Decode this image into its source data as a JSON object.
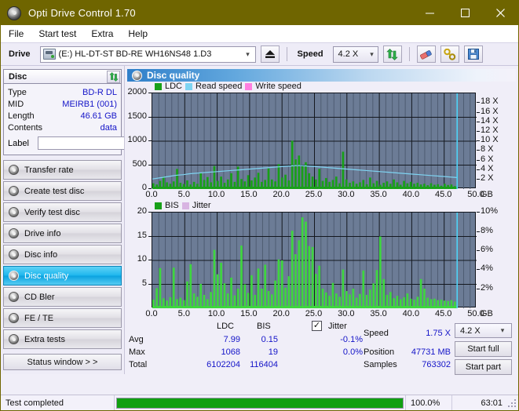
{
  "window": {
    "title": "Opti Drive Control 1.70",
    "app_icon": "disc-icon",
    "minimize": "minimize-icon",
    "maximize": "maximize-icon",
    "close": "close-icon"
  },
  "menu": {
    "items": [
      "File",
      "Start test",
      "Extra",
      "Help"
    ]
  },
  "toolbar": {
    "drive_label": "Drive",
    "drive_value": "(E:)  HL-DT-ST BD-RE  WH16NS48 1.D3",
    "eject_icon": "eject-icon",
    "speed_label": "Speed",
    "speed_value": "4.2 X",
    "refresh_icon": "refresh-icon",
    "erase_icon": "eraser-icon",
    "tools_icon": "tools-icon",
    "save_icon": "save-icon"
  },
  "disc_panel": {
    "title": "Disc",
    "refresh_icon": "refresh-icon",
    "rows": [
      {
        "key": "Type",
        "value": "BD-R DL"
      },
      {
        "key": "MID",
        "value": "MEIRB1 (001)"
      },
      {
        "key": "Length",
        "value": "46.61 GB"
      },
      {
        "key": "Contents",
        "value": "data"
      }
    ],
    "label_key": "Label",
    "label_value": "",
    "label_button_icon": "disc-icon"
  },
  "nav": {
    "items": [
      {
        "label": "Transfer rate",
        "icon": "disc-icon",
        "active": false
      },
      {
        "label": "Create test disc",
        "icon": "disc-icon",
        "active": false
      },
      {
        "label": "Verify test disc",
        "icon": "disc-icon",
        "active": false
      },
      {
        "label": "Drive info",
        "icon": "disc-icon",
        "active": false
      },
      {
        "label": "Disc info",
        "icon": "disc-icon",
        "active": false
      },
      {
        "label": "Disc quality",
        "icon": "disc-icon",
        "active": true
      },
      {
        "label": "CD Bler",
        "icon": "disc-icon",
        "active": false
      },
      {
        "label": "FE / TE",
        "icon": "disc-icon",
        "active": false
      },
      {
        "label": "Extra tests",
        "icon": "disc-icon",
        "active": false
      }
    ],
    "status_window": "Status window > >"
  },
  "main": {
    "header": "Disc quality",
    "header_icon": "disc-icon"
  },
  "chart_data": [
    {
      "type": "line",
      "title": "LDC / Read speed",
      "legend": [
        {
          "label": "LDC",
          "color": "#18a018"
        },
        {
          "label": "Read speed",
          "color": "#7fd4f2"
        },
        {
          "label": "Write speed",
          "color": "#ff7fe0"
        }
      ],
      "legend_position": "top-left",
      "xlabel": "GB",
      "x_ticks": [
        "0.0",
        "5.0",
        "10.0",
        "15.0",
        "20.0",
        "25.0",
        "30.0",
        "35.0",
        "40.0",
        "45.0",
        "50.0"
      ],
      "xlim": [
        0,
        50
      ],
      "ylabel_left": "LDC",
      "y_ticks_left": [
        "0",
        "500",
        "1000",
        "1500",
        "2000"
      ],
      "ylim_left": [
        0,
        2000
      ],
      "ylabel_right": "Speed",
      "y_ticks_right": [
        "2 X",
        "4 X",
        "6 X",
        "8 X",
        "10 X",
        "12 X",
        "14 X",
        "16 X",
        "18 X"
      ],
      "ylim_right": [
        0,
        20
      ],
      "grid": true,
      "plot_bg": "#6c7c96",
      "series": [
        {
          "name": "LDC",
          "color": "#18a018",
          "type": "bar",
          "values": [
            120,
            95,
            170,
            260,
            140,
            110,
            160,
            420,
            130,
            105,
            180,
            95,
            150,
            110,
            330,
            190,
            250,
            140,
            480,
            170,
            260,
            130,
            200,
            330,
            150,
            470,
            210,
            160,
            290,
            180,
            240,
            340,
            150,
            190,
            430,
            200,
            160,
            520,
            240,
            300,
            180,
            1010,
            620,
            700,
            480,
            560,
            330,
            260,
            200,
            420,
            170,
            230,
            150,
            190,
            260,
            120,
            780,
            200,
            130,
            160,
            110,
            140,
            190,
            100,
            240,
            120,
            170,
            90,
            130,
            160,
            110,
            200,
            140,
            90,
            170,
            120,
            150,
            110,
            130,
            95,
            110,
            80,
            120,
            90,
            100,
            70,
            110,
            85,
            95,
            60
          ]
        },
        {
          "name": "Read speed",
          "color": "#7fd4f2",
          "type": "line",
          "values": [
            2.1,
            2.3,
            2.5,
            2.7,
            2.9,
            3.0,
            3.2,
            3.3,
            3.4,
            3.5,
            3.6,
            3.7,
            3.8,
            3.9,
            4.0,
            4.1,
            4.2,
            4.3,
            4.4,
            4.5,
            4.6,
            4.7,
            4.8,
            4.9,
            4.9,
            4.8,
            4.7,
            4.6,
            4.5,
            4.4,
            4.3,
            4.2,
            4.1,
            4.0,
            3.9,
            3.8,
            3.7,
            3.6,
            3.5,
            3.4,
            3.3,
            3.2,
            3.1,
            3.0,
            2.9,
            2.8,
            2.7,
            2.6,
            2.5,
            2.4
          ]
        }
      ],
      "end_marker": {
        "x": 47.0,
        "color": "#4fd3f7"
      }
    },
    {
      "type": "line",
      "title": "BIS / Jitter",
      "legend": [
        {
          "label": "BIS",
          "color": "#18a018"
        },
        {
          "label": "Jitter",
          "color": "#d8b4e2"
        }
      ],
      "legend_position": "top-left",
      "xlabel": "GB",
      "x_ticks": [
        "0.0",
        "5.0",
        "10.0",
        "15.0",
        "20.0",
        "25.0",
        "30.0",
        "35.0",
        "40.0",
        "45.0",
        "50.0"
      ],
      "xlim": [
        0,
        50
      ],
      "ylabel_left": "BIS",
      "y_ticks_left": [
        "5",
        "10",
        "15",
        "20"
      ],
      "ylim_left": [
        0,
        20
      ],
      "ylabel_right": "Jitter",
      "y_ticks_right": [
        "2%",
        "4%",
        "6%",
        "8%",
        "10%"
      ],
      "ylim_right": [
        0,
        10
      ],
      "grid": true,
      "plot_bg": "#6c7c96",
      "series": [
        {
          "name": "BIS",
          "color": "#3ed63e",
          "type": "bar",
          "values": [
            1.8,
            4.2,
            8.4,
            2.1,
            1.6,
            2.3,
            8.5,
            1.9,
            2.2,
            1.7,
            5.6,
            9.2,
            3.1,
            2.4,
            5.1,
            2.8,
            1.9,
            3.4,
            12.2,
            7.1,
            9.5,
            5.2,
            3.1,
            6.4,
            2.7,
            4.1,
            13.1,
            5.0,
            3.2,
            6.9,
            2.8,
            8.3,
            4.1,
            9.1,
            3.6,
            2.9,
            5.8,
            10.2,
            10.0,
            4.3,
            6.7,
            16.2,
            11.3,
            14.2,
            19.0,
            18.1,
            13.0,
            12.8,
            7.2,
            8.9,
            4.1,
            3.3,
            2.6,
            5.3,
            3.1,
            2.4,
            8.1,
            3.6,
            2.9,
            4.1,
            2.2,
            3.0,
            7.9,
            2.8,
            3.9,
            5.2,
            8.0,
            15.0,
            6.1,
            2.8,
            3.4,
            2.1,
            2.6,
            1.9,
            2.3,
            3.1,
            2.0,
            1.8,
            2.4,
            6.1,
            4.1,
            2.2,
            1.9,
            2.0,
            1.7,
            1.8,
            1.6,
            1.5,
            1.7,
            1.4
          ]
        }
      ],
      "end_marker": {
        "x": 47.0,
        "color": "#4fd3f7"
      }
    }
  ],
  "stats": {
    "col_headers": [
      "LDC",
      "BIS"
    ],
    "row_labels": [
      "Avg",
      "Max",
      "Total"
    ],
    "ldc": {
      "avg": "7.99",
      "max": "1068",
      "total": "6102204"
    },
    "bis": {
      "avg": "0.15",
      "max": "19",
      "total": "116404"
    },
    "jitter": {
      "label": "Jitter",
      "checked": true,
      "avg": "-0.1%",
      "max": "0.0%"
    },
    "speed_label": "Speed",
    "speed_value": "1.75 X",
    "position_label": "Position",
    "position_value": "47731 MB",
    "samples_label": "Samples",
    "samples_value": "763302",
    "speed_select": "4.2 X",
    "start_full": "Start full",
    "start_part": "Start part"
  },
  "statusbar": {
    "message": "Test completed",
    "progress_percent": 100.0,
    "progress_text": "100.0%",
    "elapsed": "63:01"
  }
}
